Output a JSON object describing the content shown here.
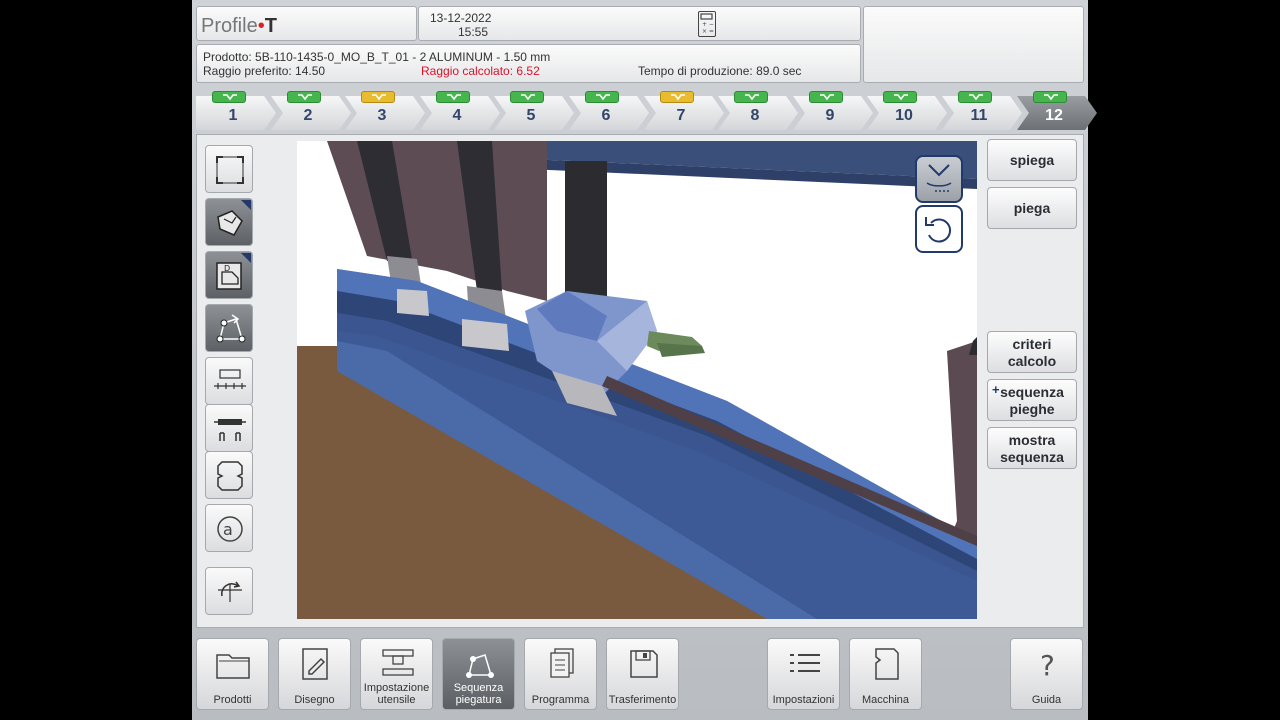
{
  "header": {
    "brand_prefix": "Profile",
    "brand_dot": "•",
    "brand_suffix": "T",
    "date": "13-12-2022",
    "time": "15:55"
  },
  "info": {
    "product": "Prodotto: 5B-110-1435-0_MO_B_T_01 - 2 ALUMINUM - 1.50 mm",
    "preferred_radius": "Raggio preferito: 14.50",
    "calculated_radius": "Raggio calcolato: 6.52",
    "production_time": "Tempo di produzione: 89.0 sec"
  },
  "steps": [
    {
      "label": "1",
      "status": "green"
    },
    {
      "label": "2",
      "status": "green"
    },
    {
      "label": "3",
      "status": "yellow"
    },
    {
      "label": "4",
      "status": "green"
    },
    {
      "label": "5",
      "status": "green"
    },
    {
      "label": "6",
      "status": "green"
    },
    {
      "label": "7",
      "status": "yellow"
    },
    {
      "label": "8",
      "status": "green"
    },
    {
      "label": "9",
      "status": "green"
    },
    {
      "label": "10",
      "status": "green"
    },
    {
      "label": "11",
      "status": "green"
    },
    {
      "label": "12",
      "status": "green",
      "active": true
    }
  ],
  "right_buttons": {
    "unfold": "spiega",
    "fold": "piega",
    "criteria_1": "criteri",
    "criteria_2": "calcolo",
    "sequence_1": "sequenza",
    "sequence_2": "pieghe",
    "show_1": "mostra",
    "show_2": "sequenza"
  },
  "toolbar": {
    "products": "Prodotti",
    "drawing": "Disegno",
    "tool_setup_1": "Impostazione",
    "tool_setup_2": "utensile",
    "bend_seq_1": "Sequenza",
    "bend_seq_2": "piegatura",
    "program": "Programma",
    "transfer": "Trasferimento",
    "settings": "Impostazioni",
    "machine": "Macchina",
    "help": "Guida"
  },
  "colors": {
    "accent": "#213a6b",
    "status_green": "#46b54d",
    "status_yellow": "#e9bb2f",
    "warning_red": "#d8132a"
  }
}
